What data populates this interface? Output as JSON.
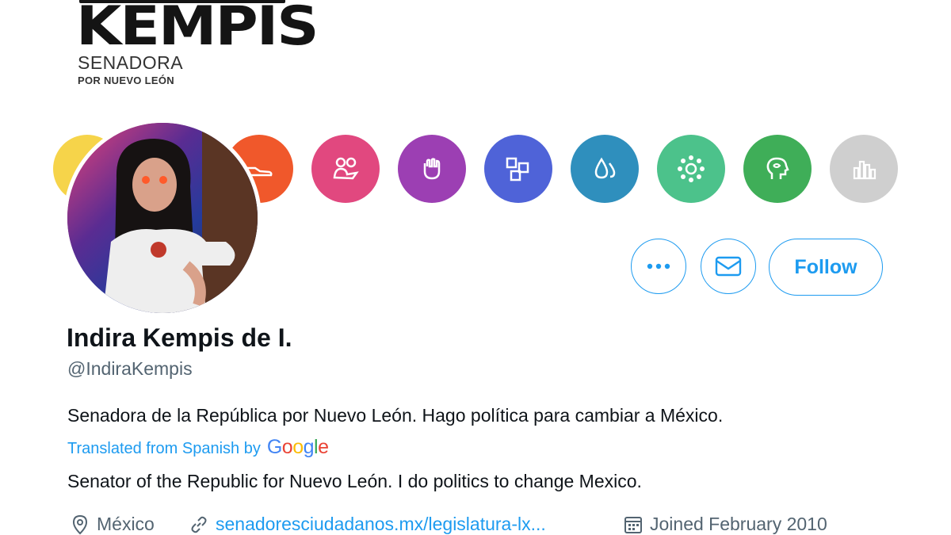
{
  "banner": {
    "brand_name": "KEMPIS",
    "brand_line1": "SENADORA",
    "brand_line2": "POR NUEVO LEÓN",
    "circles": [
      {
        "icon": "partial-yellow",
        "color": "#f6d44a"
      },
      {
        "icon": "shoe-icon",
        "color": "#f0582b"
      },
      {
        "icon": "people-icon",
        "color": "#e1487f"
      },
      {
        "icon": "fist-icon",
        "color": "#9c3fb3"
      },
      {
        "icon": "boxes-icon",
        "color": "#4f63d8"
      },
      {
        "icon": "drops-icon",
        "color": "#2f8fbd"
      },
      {
        "icon": "network-icon",
        "color": "#4cc28b"
      },
      {
        "icon": "head-icon",
        "color": "#3fae58"
      },
      {
        "icon": "chart-icon",
        "color": "#cfcfcf"
      }
    ]
  },
  "actions": {
    "more_icon": "more-dots-icon",
    "message_icon": "envelope-icon",
    "follow_label": "Follow"
  },
  "profile": {
    "display_name": "Indira Kempis de I.",
    "handle": "@IndiraKempis",
    "bio": "Senadora de la República por Nuevo León. Hago política para cambiar a México.",
    "translated_label": "Translated from Spanish by",
    "translator_brand": "Google",
    "bio_translated": "Senator of the Republic for Nuevo León. I do politics to change Mexico.",
    "location": "México",
    "website": "senadoresciudadanos.mx/legislatura-lx...",
    "joined": "Joined February 2010"
  },
  "colors": {
    "accent": "#1d9bf0",
    "secondary_text": "#536471",
    "primary_text": "#0f1419"
  }
}
